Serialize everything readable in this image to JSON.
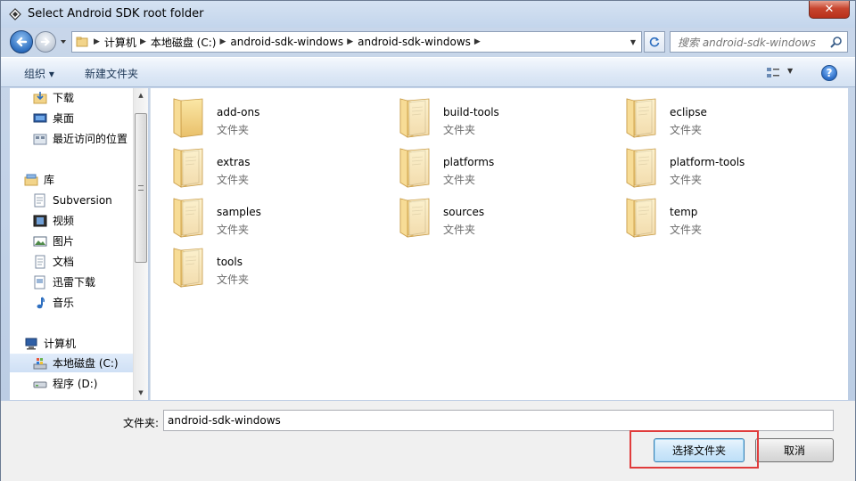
{
  "window": {
    "title": "Select Android SDK root folder"
  },
  "address": {
    "crumbs": [
      "计算机",
      "本地磁盘 (C:)",
      "android-sdk-windows",
      "android-sdk-windows"
    ]
  },
  "search": {
    "placeholder": "搜索 android-sdk-windows"
  },
  "toolbar": {
    "organize_label": "组织 ▾",
    "new_folder_label": "新建文件夹"
  },
  "nav": {
    "items": [
      {
        "label": "下载",
        "icon": "download-folder-icon"
      },
      {
        "label": "桌面",
        "icon": "desktop-icon"
      },
      {
        "label": "最近访问的位置",
        "icon": "recent-places-icon"
      },
      {
        "label": "库",
        "icon": "library-icon"
      },
      {
        "label": "Subversion",
        "icon": "library-folder-icon"
      },
      {
        "label": "视频",
        "icon": "video-library-icon"
      },
      {
        "label": "图片",
        "icon": "pictures-library-icon"
      },
      {
        "label": "文档",
        "icon": "documents-library-icon"
      },
      {
        "label": "迅雷下载",
        "icon": "thunder-download-icon"
      },
      {
        "label": "音乐",
        "icon": "music-library-icon"
      },
      {
        "label": "计算机",
        "icon": "computer-icon"
      },
      {
        "label": "本地磁盘 (C:)",
        "icon": "system-drive-icon",
        "selected": true
      },
      {
        "label": "程序 (D:)",
        "icon": "drive-icon"
      }
    ]
  },
  "folders": [
    {
      "name": "add-ons",
      "type": "文件夹"
    },
    {
      "name": "build-tools",
      "type": "文件夹"
    },
    {
      "name": "eclipse",
      "type": "文件夹"
    },
    {
      "name": "extras",
      "type": "文件夹"
    },
    {
      "name": "platforms",
      "type": "文件夹"
    },
    {
      "name": "platform-tools",
      "type": "文件夹"
    },
    {
      "name": "samples",
      "type": "文件夹"
    },
    {
      "name": "sources",
      "type": "文件夹"
    },
    {
      "name": "temp",
      "type": "文件夹"
    },
    {
      "name": "tools",
      "type": "文件夹"
    }
  ],
  "footer": {
    "folder_label": "文件夹:",
    "folder_value": "android-sdk-windows",
    "select_label": "选择文件夹",
    "cancel_label": "取消"
  },
  "colors": {
    "accent": "#2e6fc0",
    "highlight": "#e03c3c",
    "folder": "#f2d48a"
  }
}
